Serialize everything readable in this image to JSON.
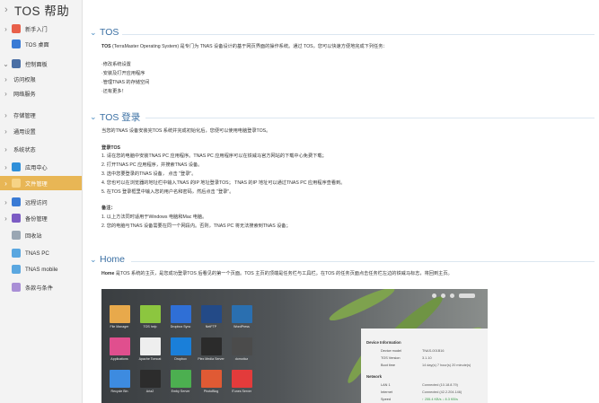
{
  "app": {
    "title_prefix": "TOS",
    "title_suffix": "帮助"
  },
  "sidebar": {
    "items": [
      {
        "label": "新手入门",
        "chev": "›",
        "color": "#e8604a"
      },
      {
        "label": "TOS 桌面",
        "chev": "",
        "color": "#3a7bd5"
      },
      {
        "label": "控制面板",
        "chev": "⌄",
        "color": "#4a6fa5"
      },
      {
        "label": "访问权限",
        "chev": "›",
        "color": ""
      },
      {
        "label": "网络服务",
        "chev": "›",
        "color": ""
      },
      {
        "label": "存储管理",
        "chev": "›",
        "color": ""
      },
      {
        "label": "通用设置",
        "chev": "›",
        "color": ""
      },
      {
        "label": "系统状态",
        "chev": "›",
        "color": ""
      },
      {
        "label": "应用中心",
        "chev": "›",
        "color": "#2f8fd9"
      },
      {
        "label": "文件管理",
        "chev": "›",
        "color": "#e8b655"
      },
      {
        "label": "远程访问",
        "chev": "›",
        "color": "#3a7bd5"
      },
      {
        "label": "备份管理",
        "chev": "›",
        "color": "#7c5cc4"
      },
      {
        "label": "回收站",
        "chev": "",
        "color": "#9aa6b3"
      },
      {
        "label": "TNAS PC",
        "chev": "",
        "color": "#5aa7e0"
      },
      {
        "label": "TNAS mobile",
        "chev": "",
        "color": "#5aa7e0"
      },
      {
        "label": "条款与条件",
        "chev": "",
        "color": "#a98fd6"
      }
    ]
  },
  "sections": {
    "tos": {
      "title": "TOS",
      "intro_bold": "TOS",
      "intro": " (TerraMaster Operating System) 是专门为 TNAS 设备设计的基于网页界面的操作系统。通过 TOS，您可以快速方便地完成下列任务：",
      "list": [
        "·修改系统设置",
        "·安装及打开应用程序",
        "·管理TNAS 的存储空间",
        "·还有更多！"
      ]
    },
    "login": {
      "title": "TOS 登录",
      "intro": "当您的TNAS 设备安装完TOS 系统并完成初始化后，您便可以使用电脑登录TOS。",
      "steps_title": "登录TOS",
      "steps": [
        "1.  请在您的电脑中安装TNAS PC 应用程序。TNAS PC 应用程序可以在铁威马官方网站的下载中心免费下载；",
        "2.  打开TNAS PC 应用程序，并搜索TNAS 设备。",
        "3.  选中您要登录的TNAS 设备，  点击 \"登录\"。",
        "4.  您也可以在浏览器的地址栏中输入TNAS 的IP 地址登录TOS；  TNAS 的IP 地址可以通过TNAS PC 应用程序查看到。",
        "5.  在TOS 登录框里中输入您的用户名和密码，然后点击 \"登录\"。"
      ],
      "notes_title": "备注：",
      "notes": [
        "1.  以上方法同时适用于Windows 电脑和Mac 电脑。",
        "2.  您的电脑与TNAS 设备需要在同一个网段内。否则，TNAS PC 将无法搜索到TNAS 设备；"
      ]
    },
    "home": {
      "title": "Home",
      "intro_bold": "Home",
      "intro": " 是TOS 系统的主页，是您成功登录TOS 后看见的第一个页面。TOS 主页的顶端是任务栏与工具栏。在TOS 的任务页面点击任务栏左边的铁威马标志，将回到主页。"
    }
  },
  "screenshot": {
    "tiles": [
      {
        "label": "File Manager",
        "color": "#e8a94b"
      },
      {
        "label": "TOS help",
        "color": "#8cc63f"
      },
      {
        "label": "Dropbox Sync",
        "color": "#2f6fd6"
      },
      {
        "label": "NetFTP",
        "color": "#234a87"
      },
      {
        "label": "WordPress",
        "color": "#2a6fb0"
      },
      {
        "label": "Applications",
        "color": "#e04f8e"
      },
      {
        "label": "Apache Tomcat",
        "color": "#eeeeee"
      },
      {
        "label": "Dropbox",
        "color": "#1a7fd9"
      },
      {
        "label": "Plex Media Server",
        "color": "#2b2b2b"
      },
      {
        "label": "domoticz",
        "color": "#4b4b4b"
      },
      {
        "label": "Recycle Bin",
        "color": "#3d8be0"
      },
      {
        "label": "Aria2",
        "color": "#2c2c2c"
      },
      {
        "label": "Emby Server",
        "color": "#4caf50"
      },
      {
        "label": "PhotoBlog",
        "color": "#e05a34"
      },
      {
        "label": "iTunes Server",
        "color": "#e33b3b"
      }
    ],
    "panel": {
      "device_title": "Device Information",
      "device_rows": [
        {
          "k": "Device model",
          "v": "TNAS-001B16"
        },
        {
          "k": "TOS Version",
          "v": "3.1.10"
        },
        {
          "k": "Boot time",
          "v": "14 day(s) 7 hour(s) 20 minute(s)"
        }
      ],
      "network_title": "Network",
      "network_rows": [
        {
          "k": "LAN 1",
          "v": "Connected (10.18.8.79)"
        },
        {
          "k": "Internet",
          "v": "Connected (42.2.204.146)"
        },
        {
          "k": "Speed",
          "v": "↑ 255.4 KB/s   ↓ 8.3 KB/s"
        }
      ]
    }
  }
}
